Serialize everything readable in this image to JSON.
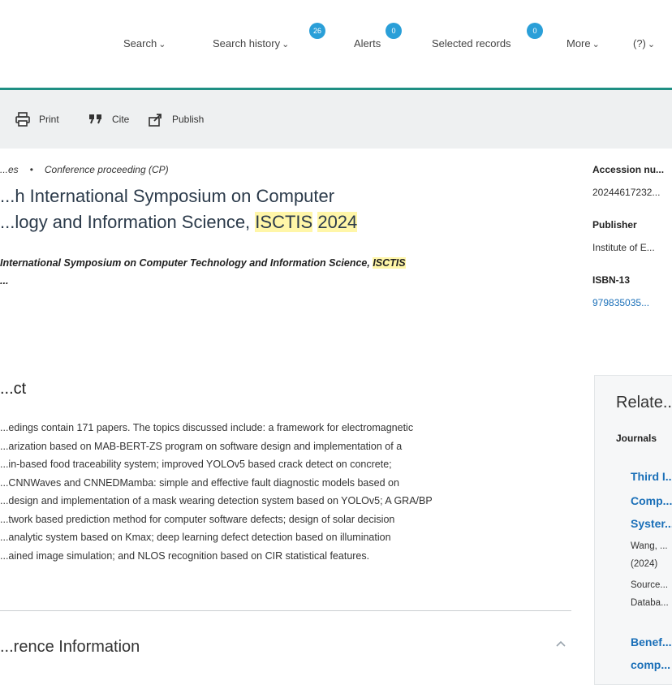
{
  "nav": {
    "items": [
      {
        "label": "Search"
      },
      {
        "label": "Search history"
      },
      {
        "label": "Alerts"
      },
      {
        "label": "Selected records"
      },
      {
        "label": "More"
      }
    ],
    "lang": "(?)",
    "badges": [
      "26",
      "0",
      "0"
    ]
  },
  "toolbar": {
    "print": "Print",
    "cite": "Cite",
    "publish": "Publish"
  },
  "breadcrumb": {
    "prev": "...es",
    "current": "Conference proceeding (CP)"
  },
  "title": {
    "part1": "...h International Symposium on Computer",
    "part2": "...logy and Information Science, ",
    "hl1": "ISCTIS",
    "hl2": "2024"
  },
  "source": {
    "line1": "International Symposium on Computer Technology and Information Science, ",
    "hl": "ISCTIS",
    "line2": "..."
  },
  "abstract": {
    "heading": "...ct",
    "lines": [
      "...edings contain 171 papers. The topics discussed include: a framework for electromagnetic",
      "...arization based on MAB-BERT-ZS program on software design and implementation of a",
      "...in-based food traceability system; improved YOLOv5 based crack detect on concrete;",
      "...CNNWaves and CNNEDMamba: simple and effective fault diagnostic models based on",
      "...design and implementation of a mask wearing detection system based on YOLOv5; A GRA/BP",
      "...twork based prediction method for computer software defects; design of solar decision",
      "...analytic system based on Kmax; deep learning defect detection based on illumination",
      "...ained image simulation; and NLOS recognition based on CIR statistical features."
    ]
  },
  "conference_info": {
    "heading": "...rence Information"
  },
  "meta": {
    "accession_label": "Accession nu...",
    "accession_value": "20244617232...",
    "publisher_label": "Publisher",
    "publisher_value": "Institute of E...",
    "isbn_label": "ISBN-13",
    "isbn_value": "979835035..."
  },
  "related": {
    "heading": "Relate...",
    "subheading": "Journals",
    "items": [
      {
        "l1": "Third I...",
        "l2": "Comp...",
        "l3": "Syster...",
        "t1": "Wang, ...",
        "t2": "(2024)",
        "t3": "Source...",
        "t4": "Databa..."
      },
      {
        "l1": "Benef...",
        "l2": "comp..."
      }
    ]
  },
  "colors": {
    "accent": "#1f8f83",
    "badge": "#2a9fd8",
    "link": "#1a6fb8",
    "highlight": "#fff6a8"
  }
}
